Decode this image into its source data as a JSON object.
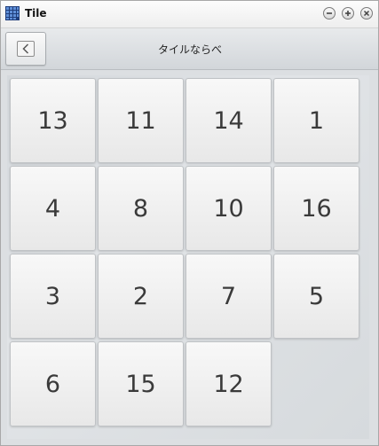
{
  "window": {
    "title": "Tile",
    "icon": "grid-app-icon"
  },
  "toolbar": {
    "title": "タイルならべ",
    "back_icon": "chevron-left-icon"
  },
  "board": {
    "columns": 4,
    "tiles": [
      13,
      11,
      14,
      1,
      4,
      8,
      10,
      16,
      3,
      2,
      7,
      5,
      6,
      15,
      12,
      null
    ]
  },
  "colors": {
    "titlebar": "#f4f4f4",
    "toolbar": "#d9dcdf",
    "tile_text": "#3a3a3a",
    "app_icon": "#1f3d7a"
  }
}
